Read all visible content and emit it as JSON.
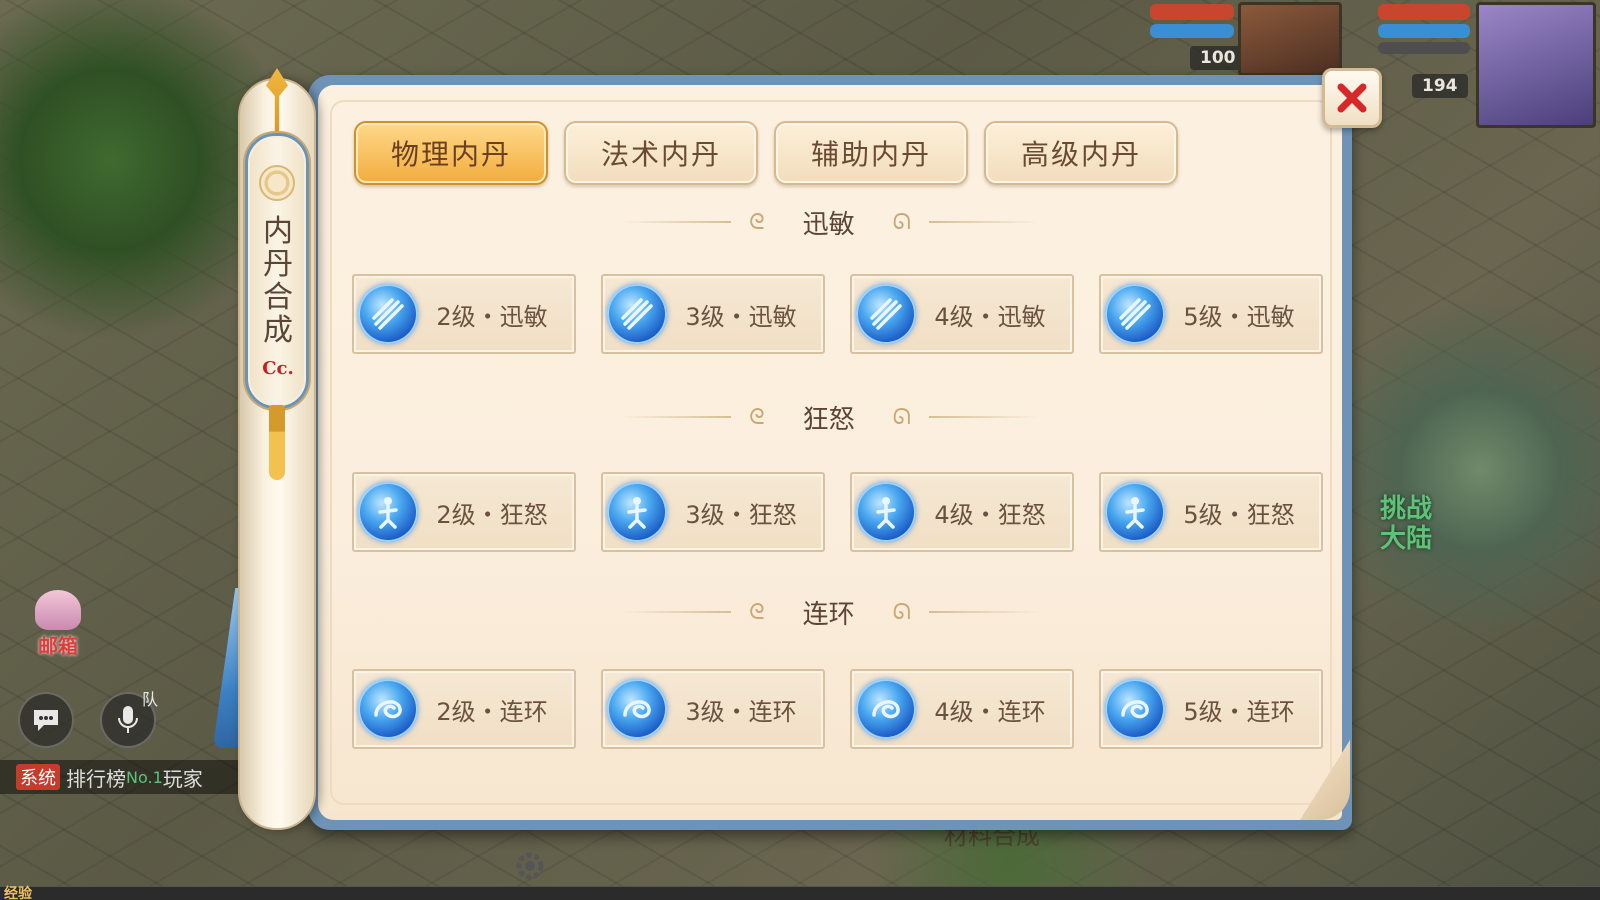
{
  "hud": {
    "player_level": "100",
    "pet_level": "194",
    "side_text_1": "挑战",
    "side_text_2": "大陆",
    "mailbox_label": "邮箱",
    "team_label": "队",
    "bottom_scene_text": "材料合成",
    "exp_label": "经验",
    "chat": {
      "channel": "系统",
      "text_prefix": "排行榜",
      "text_highlight": "No.1",
      "text_suffix": "玩家"
    }
  },
  "dialog": {
    "title": "内丹合成",
    "stamp": "Cc.",
    "tabs": [
      {
        "label": "物理内丹",
        "active": true
      },
      {
        "label": "法术内丹",
        "active": false
      },
      {
        "label": "辅助内丹",
        "active": false
      },
      {
        "label": "高级内丹",
        "active": false
      }
    ],
    "sections": [
      {
        "title": "迅敏",
        "icon": "swift-icon",
        "items": [
          "2级・迅敏",
          "3级・迅敏",
          "4级・迅敏",
          "5级・迅敏"
        ]
      },
      {
        "title": "狂怒",
        "icon": "fury-icon",
        "items": [
          "2级・狂怒",
          "3级・狂怒",
          "4级・狂怒",
          "5级・狂怒"
        ]
      },
      {
        "title": "连环",
        "icon": "combo-icon",
        "items": [
          "2级・连环",
          "3级・连环",
          "4级・连环",
          "5级・连环"
        ]
      }
    ]
  },
  "colors": {
    "active_tab": "#f2ac3e",
    "close_x": "#d62828",
    "orb_blue": "#1d5fc8",
    "panel_border": "#6e93b7"
  }
}
